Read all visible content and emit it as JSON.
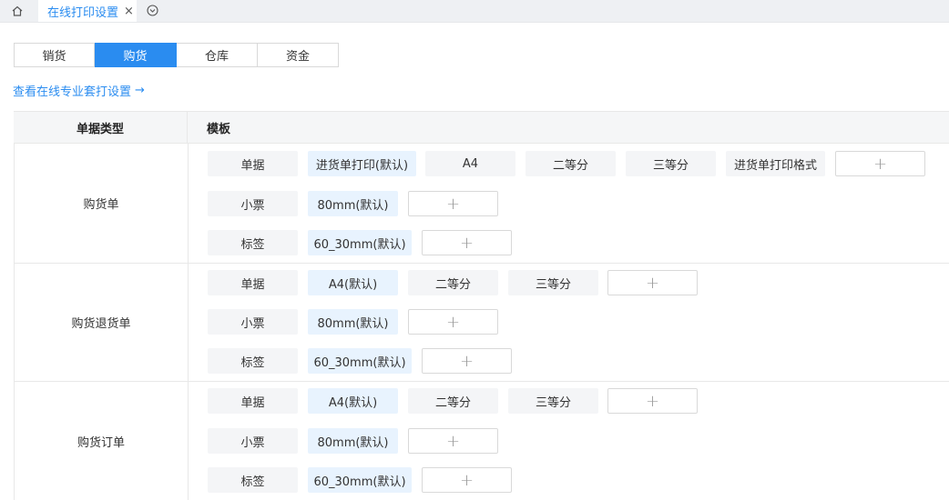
{
  "topbar": {
    "home_icon": "home-icon",
    "tab_label": "在线打印设置",
    "close_glyph": "×",
    "more_icon": "chevron-circle-down-icon"
  },
  "segments": [
    "销货",
    "购货",
    "仓库",
    "资金"
  ],
  "active_segment": 1,
  "pro_link": {
    "label": "查看在线专业套打设置",
    "arrow": "→"
  },
  "table": {
    "headers": {
      "type": "单据类型",
      "template": "模板"
    },
    "add_glyph": "+",
    "groups": [
      {
        "type": "购货单",
        "rows": [
          {
            "kind": "单据",
            "templates": [
              "进货单打印(默认)",
              "A4",
              "二等分",
              "三等分",
              "进货单打印格式"
            ]
          },
          {
            "kind": "小票",
            "templates": [
              "80mm(默认)"
            ]
          },
          {
            "kind": "标签",
            "templates": [
              "60_30mm(默认)"
            ]
          }
        ]
      },
      {
        "type": "购货退货单",
        "rows": [
          {
            "kind": "单据",
            "templates": [
              "A4(默认)",
              "二等分",
              "三等分"
            ]
          },
          {
            "kind": "小票",
            "templates": [
              "80mm(默认)"
            ]
          },
          {
            "kind": "标签",
            "templates": [
              "60_30mm(默认)"
            ]
          }
        ]
      },
      {
        "type": "购货订单",
        "rows": [
          {
            "kind": "单据",
            "templates": [
              "A4(默认)",
              "二等分",
              "三等分"
            ]
          },
          {
            "kind": "小票",
            "templates": [
              "80mm(默认)"
            ]
          },
          {
            "kind": "标签",
            "templates": [
              "60_30mm(默认)"
            ]
          }
        ]
      }
    ]
  },
  "colors": {
    "accent": "#2a8cf0",
    "default_pill_bg": "#e8f3fe",
    "pill_bg": "#f4f5f7"
  }
}
